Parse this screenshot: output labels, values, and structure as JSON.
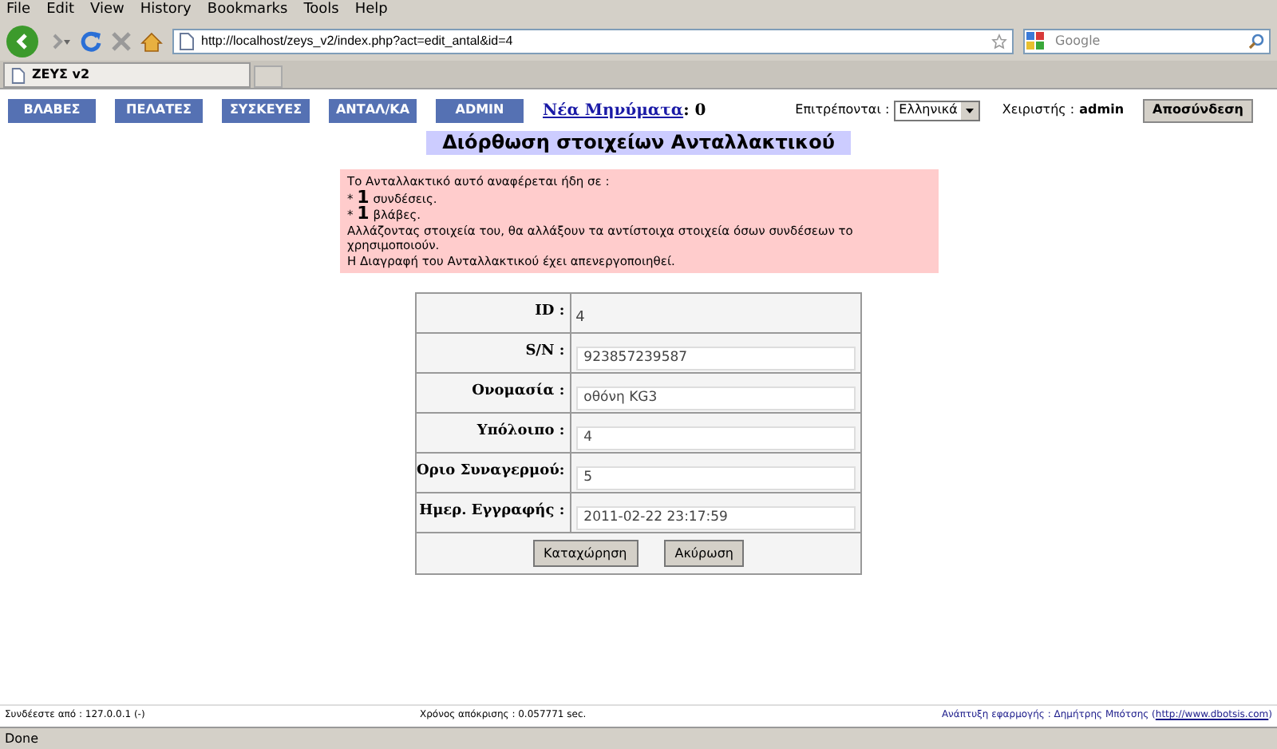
{
  "browser": {
    "menu": [
      "File",
      "Edit",
      "View",
      "History",
      "Bookmarks",
      "Tools",
      "Help"
    ],
    "url": "http://localhost/zeys_v2/index.php?act=edit_antal&id=4",
    "search": {
      "placeholder": "Google"
    },
    "tabs": [
      {
        "title": "ΖΕΥΣ v2",
        "selected": true
      }
    ],
    "status": "Done"
  },
  "nav": {
    "buttons": [
      "ΒΛΑΒΕΣ",
      "ΠΕΛΑΤΕΣ",
      "ΣΥΣΚΕΥΕΣ",
      "ΑΝΤΑΛ/ΚΑ",
      "ADMIN"
    ],
    "messages_link": "Νέα Μηνύματα",
    "messages_sep": ":",
    "messages_count": "0",
    "language_label": "Επιτρέπονται :",
    "language_value": "Ελληνικά",
    "user_label": "Χειριστής :",
    "user": "admin",
    "logout": "Αποσύνδεση"
  },
  "title": "Διόρθωση στοιχείων Ανταλλακτικού",
  "notice": [
    {
      "kind": "text",
      "text": "Το Ανταλλακτικό αυτό αναφέρεται ήδη σε :"
    },
    {
      "kind": "bullet",
      "marker": "*",
      "count": "1",
      "text": "συνδέσεις."
    },
    {
      "kind": "bullet",
      "marker": "*",
      "count": "1",
      "text": "βλάβες."
    },
    {
      "kind": "text",
      "text": "Αλλάζοντας στοιχεία του, θα αλλάξουν τα αντίστοιχα στοιχεία όσων συνδέσεων το χρησιμοποιούν."
    },
    {
      "kind": "text",
      "text": "Η Διαγραφή του Ανταλλακτικού έχει απενεργοποιηθεί."
    }
  ],
  "form": [
    {
      "kind": "static",
      "label": "ID :",
      "value": "4"
    },
    {
      "kind": "input",
      "label": "S/N :",
      "value": "923857239587"
    },
    {
      "kind": "input",
      "label": "Ονομασία :",
      "value": "οθόνη KG3"
    },
    {
      "kind": "input",
      "label": "Υπόλοιπο :",
      "value": "4"
    },
    {
      "kind": "input",
      "label": "Οριο Συναγερμού:",
      "value": "5"
    },
    {
      "kind": "input",
      "label": "Ημερ. Εγγραφής :",
      "value": "2011-02-22 23:17:59"
    }
  ],
  "form_buttons": [
    "Καταχώρηση",
    "Ακύρωση"
  ],
  "footer": {
    "left": "Συνδέεστε από : 127.0.0.1 (-)",
    "middle": "Χρόνος απόκρισης : 0.057771 sec.",
    "right": "Ανάπτυξη εφαρμογής : Δημήτρης Μπότσης (",
    "link": "http://www.dbotsis.com",
    "right_end": ")"
  }
}
